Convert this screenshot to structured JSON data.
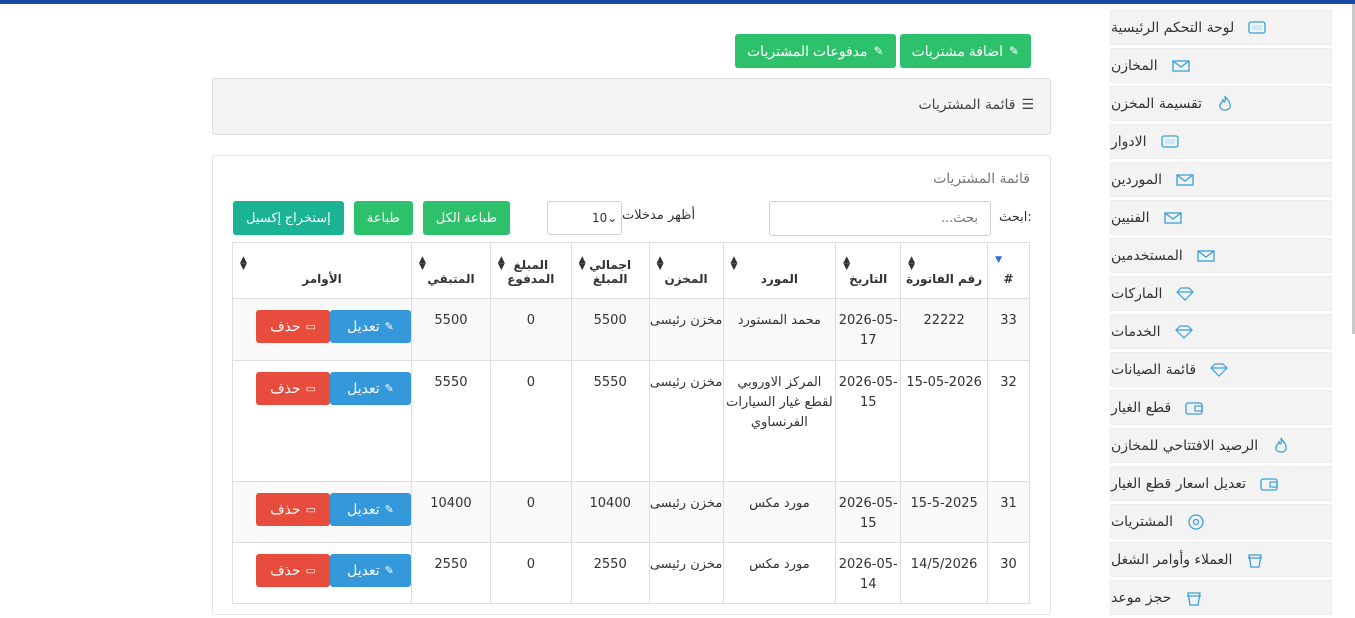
{
  "sidebar": {
    "items": [
      {
        "label": "لوحة التحكم الرئيسية",
        "icon": "monitor-icon"
      },
      {
        "label": "المخازن",
        "icon": "envelope-icon"
      },
      {
        "label": "تقسيمة المخزن",
        "icon": "fire-icon"
      },
      {
        "label": "الادوار",
        "icon": "monitor-icon"
      },
      {
        "label": "الموردين",
        "icon": "envelope-icon"
      },
      {
        "label": "الفنيين",
        "icon": "envelope-icon"
      },
      {
        "label": "المستخدمين",
        "icon": "envelope-icon"
      },
      {
        "label": "الماركات",
        "icon": "diamond-icon"
      },
      {
        "label": "الخدمات",
        "icon": "diamond-icon"
      },
      {
        "label": "قائمة الصيانات",
        "icon": "diamond-icon"
      },
      {
        "label": "قطع الغيار",
        "icon": "wallet-icon"
      },
      {
        "label": "الرصيد الافتتاحي للمخازن",
        "icon": "fire-icon"
      },
      {
        "label": "تعديل اسعار قطع الغيار",
        "icon": "wallet-icon"
      },
      {
        "label": "المشتريات",
        "icon": "disc-icon"
      },
      {
        "label": "العملاء وأوامر الشغل",
        "icon": "cup-icon"
      },
      {
        "label": "حجز موعد",
        "icon": "cup-icon"
      }
    ]
  },
  "top_buttons": {
    "add_purchase": "اضافة مشتريات",
    "purchase_payments": "مدفوعات المشتريات"
  },
  "panel": {
    "title": "قائمة المشتريات"
  },
  "card": {
    "title": "قائمة المشتريات"
  },
  "controls": {
    "search_label": "ابحث:",
    "search_placeholder": "بحث...",
    "show_entries_label": "أظهر مدخلات",
    "entries_value": "10",
    "print_all": "طباعة الكل",
    "print": "طباعة",
    "export_excel": "إستخراج إكسيل"
  },
  "table": {
    "headers": [
      "#",
      "رقم الفاتورة",
      "التاريخ",
      "المورد",
      "المخزن",
      "اجمالي المبلغ",
      "المبلغ المدفوع",
      "المتبقي",
      "الأوامر"
    ],
    "edit_label": "تعديل",
    "delete_label": "حذف",
    "rows": [
      {
        "id": "33",
        "invoice": "22222",
        "date": "2026-05-17",
        "supplier": "محمد المستورد",
        "store": "مخزن رئيسى",
        "total": "5500",
        "paid": "0",
        "remaining": "5500"
      },
      {
        "id": "32",
        "invoice": "15-05-2026",
        "date": "2026-05-15",
        "supplier": "المركز الاوروبي لقطع غيار السيارات الفرنساوي",
        "store": "مخزن رئيسى",
        "total": "5550",
        "paid": "0",
        "remaining": "5550"
      },
      {
        "id": "31",
        "invoice": "15-5-2025",
        "date": "2026-05-15",
        "supplier": "مورد مكس",
        "store": "مخزن رئيسى",
        "total": "10400",
        "paid": "0",
        "remaining": "10400"
      },
      {
        "id": "30",
        "invoice": "14/5/2026",
        "date": "2026-05-14",
        "supplier": "مورد مكس",
        "store": "مخزن رئيسى",
        "total": "2550",
        "paid": "0",
        "remaining": "2550"
      }
    ]
  }
}
